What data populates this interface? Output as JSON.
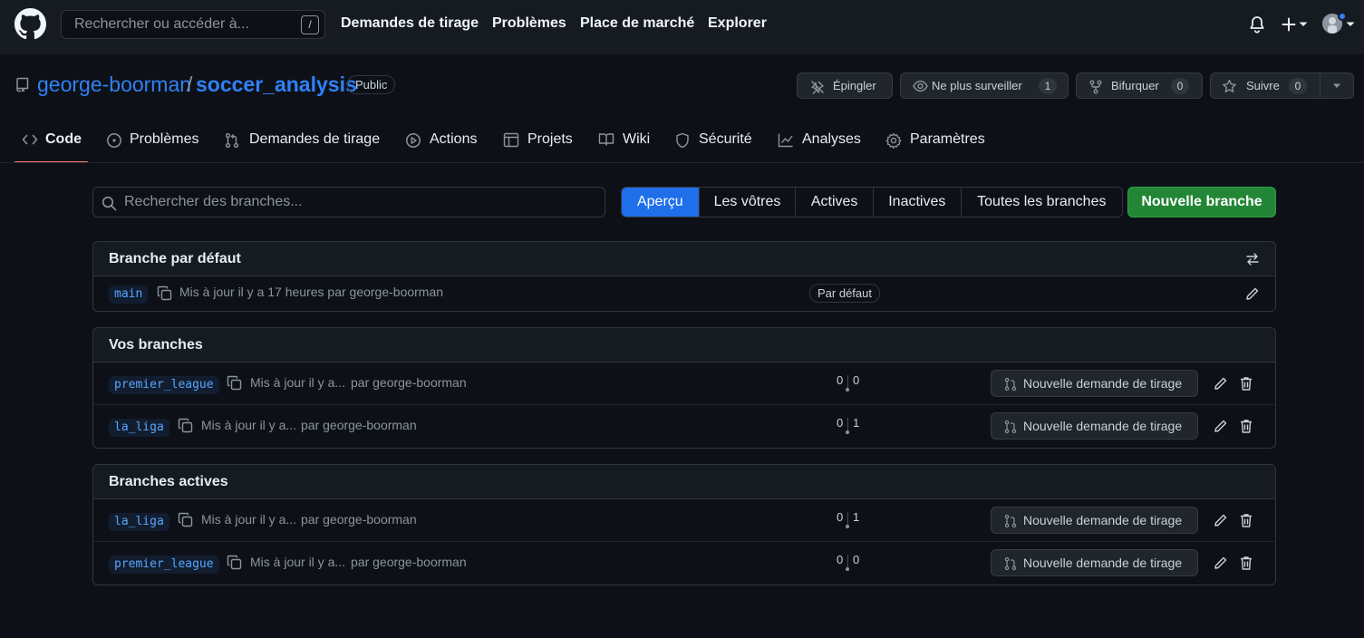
{
  "header": {
    "search_placeholder": "Rechercher ou accéder à...",
    "search_shortcut": "/",
    "nav": [
      "Demandes de tirage",
      "Problèmes",
      "Place de marché",
      "Explorer"
    ]
  },
  "repo": {
    "owner": "george-boorman",
    "separator": "/",
    "name": "soccer_analysis",
    "visibility": "Public",
    "pin_label": "Épingler",
    "watch_label": "Ne plus surveiller",
    "watch_count": "1",
    "fork_label": "Bifurquer",
    "fork_count": "0",
    "star_label": "Suivre",
    "star_count": "0"
  },
  "tabs": [
    {
      "label": "Code",
      "icon": "code-icon",
      "active": true
    },
    {
      "label": "Problèmes",
      "icon": "issue-icon"
    },
    {
      "label": "Demandes de tirage",
      "icon": "pull-request-icon"
    },
    {
      "label": "Actions",
      "icon": "play-icon"
    },
    {
      "label": "Projets",
      "icon": "table-icon"
    },
    {
      "label": "Wiki",
      "icon": "book-icon"
    },
    {
      "label": "Sécurité",
      "icon": "shield-icon"
    },
    {
      "label": "Analyses",
      "icon": "graph-icon"
    },
    {
      "label": "Paramètres",
      "icon": "gear-icon"
    }
  ],
  "branches_page": {
    "search_placeholder": "Rechercher des branches...",
    "filters": [
      "Aperçu",
      "Les vôtres",
      "Actives",
      "Inactives",
      "Toutes les branches"
    ],
    "active_filter": "Aperçu",
    "new_branch_label": "Nouvelle branche",
    "default_section": {
      "title": "Branche par défaut",
      "branch": "main",
      "meta": "Mis à jour il y a 17 heures par george-boorman",
      "badge": "Par défaut"
    },
    "your_section": {
      "title": "Vos branches",
      "rows": [
        {
          "branch": "premier_league",
          "updated": "Mis à jour il y a...",
          "by": "par george-boorman",
          "behind": "0",
          "ahead": "0",
          "pr_label": "Nouvelle demande de tirage"
        },
        {
          "branch": "la_liga",
          "updated": "Mis à jour il y a...",
          "by": "par george-boorman",
          "behind": "0",
          "ahead": "1",
          "pr_label": "Nouvelle demande de tirage"
        }
      ]
    },
    "active_section": {
      "title": "Branches actives",
      "rows": [
        {
          "branch": "la_liga",
          "updated": "Mis à jour il y a...",
          "by": "par george-boorman",
          "behind": "0",
          "ahead": "1",
          "pr_label": "Nouvelle demande de tirage"
        },
        {
          "branch": "premier_league",
          "updated": "Mis à jour il y a...",
          "by": "par george-boorman",
          "behind": "0",
          "ahead": "0",
          "pr_label": "Nouvelle demande de tirage"
        }
      ]
    }
  },
  "colors": {
    "background": "#0d1117",
    "accent": "#1f6feb",
    "link": "#2f81f7",
    "success": "#238636",
    "tab_underline": "#f78166",
    "notification_dot": "#2f81f7"
  }
}
